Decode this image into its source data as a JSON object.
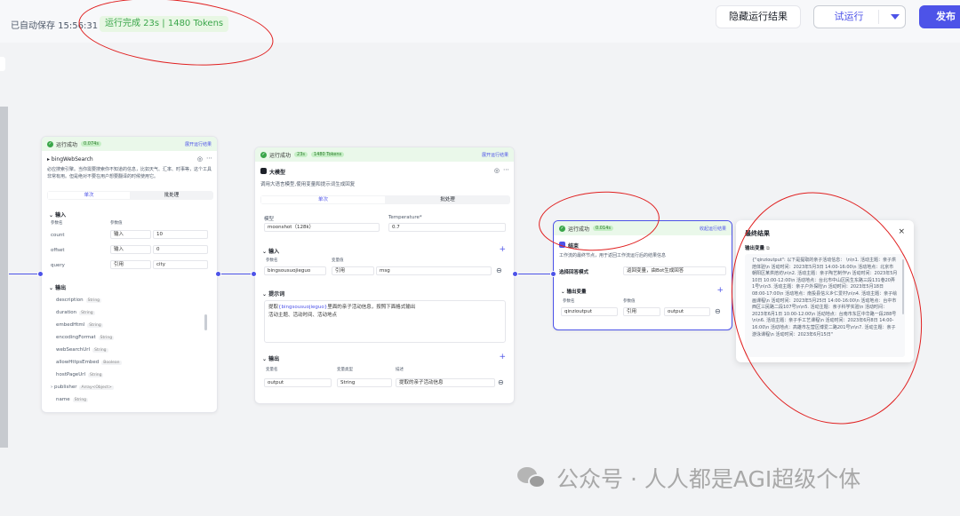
{
  "topbar": {
    "autosave": "已自动保存 15:56:31",
    "run_status": "运行完成 23s | 1480 Tokens",
    "hide_results": "隐藏运行结果",
    "test_run": "试运行",
    "publish": "发布"
  },
  "node_bing": {
    "status": "运行成功",
    "time": "0.074s",
    "toggle": "展开运行结果",
    "title": "bingWebSearch",
    "desc": "必应搜索引擎。当你需要搜索你不知道的信息，比如天气、汇率、时事等，这个工具非常有用。但是绝对不要在用户想要翻译的时候使用它。",
    "tab_single": "单次",
    "tab_batch": "批处理",
    "input_label": "输入",
    "col_name": "参数名",
    "col_value": "参数值",
    "params": [
      {
        "name": "count",
        "mode": "输入",
        "value": "10"
      },
      {
        "name": "offset",
        "mode": "输入",
        "value": "0"
      },
      {
        "name": "query",
        "mode": "引用",
        "value": "city"
      }
    ],
    "output_label": "输出",
    "outputs": [
      {
        "name": "description",
        "type": "String"
      },
      {
        "name": "duration",
        "type": "String"
      },
      {
        "name": "embedHtml",
        "type": "String"
      },
      {
        "name": "encodingFormat",
        "type": "String"
      },
      {
        "name": "webSearchUrl",
        "type": "String"
      },
      {
        "name": "allowHttpsEmbed",
        "type": "Boolean"
      },
      {
        "name": "hostPageUrl",
        "type": "String"
      },
      {
        "name": "publisher",
        "type": "Array<Object>"
      },
      {
        "name": "name",
        "type": "String"
      }
    ]
  },
  "node_llm": {
    "status": "运行成功",
    "time": "23s",
    "tokens": "1480 Tokens",
    "toggle": "展开运行结果",
    "title": "大模型",
    "desc": "调用大语言模型,使用变量和提示词生成回复",
    "tab_single": "单次",
    "tab_batch": "批处理",
    "model_label": "模型",
    "model_value": "moonshot（128k）",
    "temp_label": "Temperature*",
    "temp_value": "0.7",
    "input_label": "输入",
    "col_name": "参数名",
    "col_value": "变量值",
    "param_name": "bingsousuojieguo",
    "param_mode": "引用",
    "param_value": "msg",
    "prompt_label": "提示词",
    "prompt_var": "{bingsousuojieguo}",
    "prompt_pre": "提取",
    "prompt_post": "里面的亲子活动信息，按照下面格式输出",
    "prompt_line2": "活动主题、活动时间、活动地点",
    "output_label": "输出",
    "out_col_name": "变量名",
    "out_col_type": "变量类型",
    "out_col_desc": "描述",
    "out_name": "output",
    "out_type": "String",
    "out_desc": "提取的亲子活动信息"
  },
  "node_end": {
    "status": "运行成功",
    "time": "0.014s",
    "toggle": "收起运行结果",
    "title": "结束",
    "desc": "工作流的最终节点，用于返回工作流运行后的结果信息",
    "mode_label": "选择回答模式",
    "mode_value": "返回变量，由Bot生成回答",
    "output_label": "输出变量",
    "col_name": "参数名",
    "col_value": "参数值",
    "var_name": "qinzioutput",
    "var_mode": "引用",
    "var_value": "output"
  },
  "final": {
    "title": "最终结果",
    "sub": "输出变量",
    "text": "{\"qinzioutput\": 以下是提取的亲子活动信息： \\n\\n1. 活动主题：亲子烘焙体验\\n   活动时间：2023年5月3日 14:00-16:00\\n   活动地点：北京市朝阳区某烘焙坊\\n\\n2. 活动主题：亲子陶艺制作\\n   活动时间：2023年5月10日 10:00-12:00\\n   活动地点：台北市中山区民生东路三段131巷20弄1号\\n\\n3. 活动主题：亲子户外探险\\n   活动时间：2023年5月18日 08:00-17:00\\n   活动地点：南投县信义乡仁爱村\\n\\n4. 活动主题：亲子绘画课程\\n   活动时间：2023年5月25日 14:00-16:00\\n   活动地点：台中市西区三民路二段107号\\n\\n5. 活动主题：亲子科学实验\\n   活动时间：2023年6月1日 10:00-12:00\\n   活动地点：台南市东区中华路一段288号\\n\\n6. 活动主题：亲子手工艺课程\\n   活动时间：2023年6月8日 14:00-16:00\\n   活动地点：高雄市左营区博爱二路201号\\n\\n7. 活动主题：亲子游泳课程\\n   活动时间：2023年6月15日\""
  },
  "watermark": "公众号 · 人人都是AGI超级个体",
  "colors": {
    "accent": "#4d53e8",
    "success": "#3aa64a",
    "annotation": "#e02020"
  }
}
